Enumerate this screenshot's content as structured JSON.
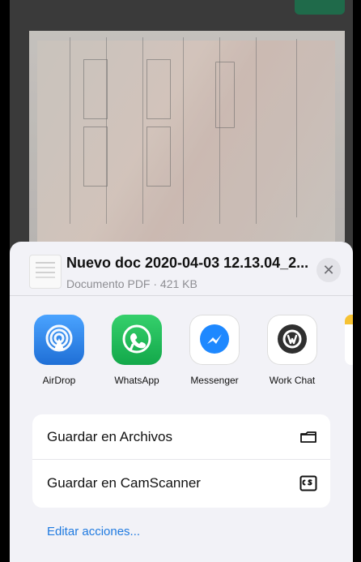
{
  "document": {
    "title": "Nuevo doc 2020-04-03 12.13.04_2...",
    "meta": "Documento PDF · 421 KB"
  },
  "share_targets": [
    {
      "label": "AirDrop"
    },
    {
      "label": "WhatsApp"
    },
    {
      "label": "Messenger"
    },
    {
      "label": "Work Chat"
    }
  ],
  "actions": [
    {
      "label": "Guardar en Archivos",
      "icon": "folder-icon"
    },
    {
      "label": "Guardar en CamScanner",
      "icon": "camscanner-icon"
    }
  ],
  "footer": {
    "edit_label": "Editar acciones..."
  },
  "colors": {
    "accent": "#1f7ae0",
    "sheet_bg": "#f2f2f7"
  }
}
